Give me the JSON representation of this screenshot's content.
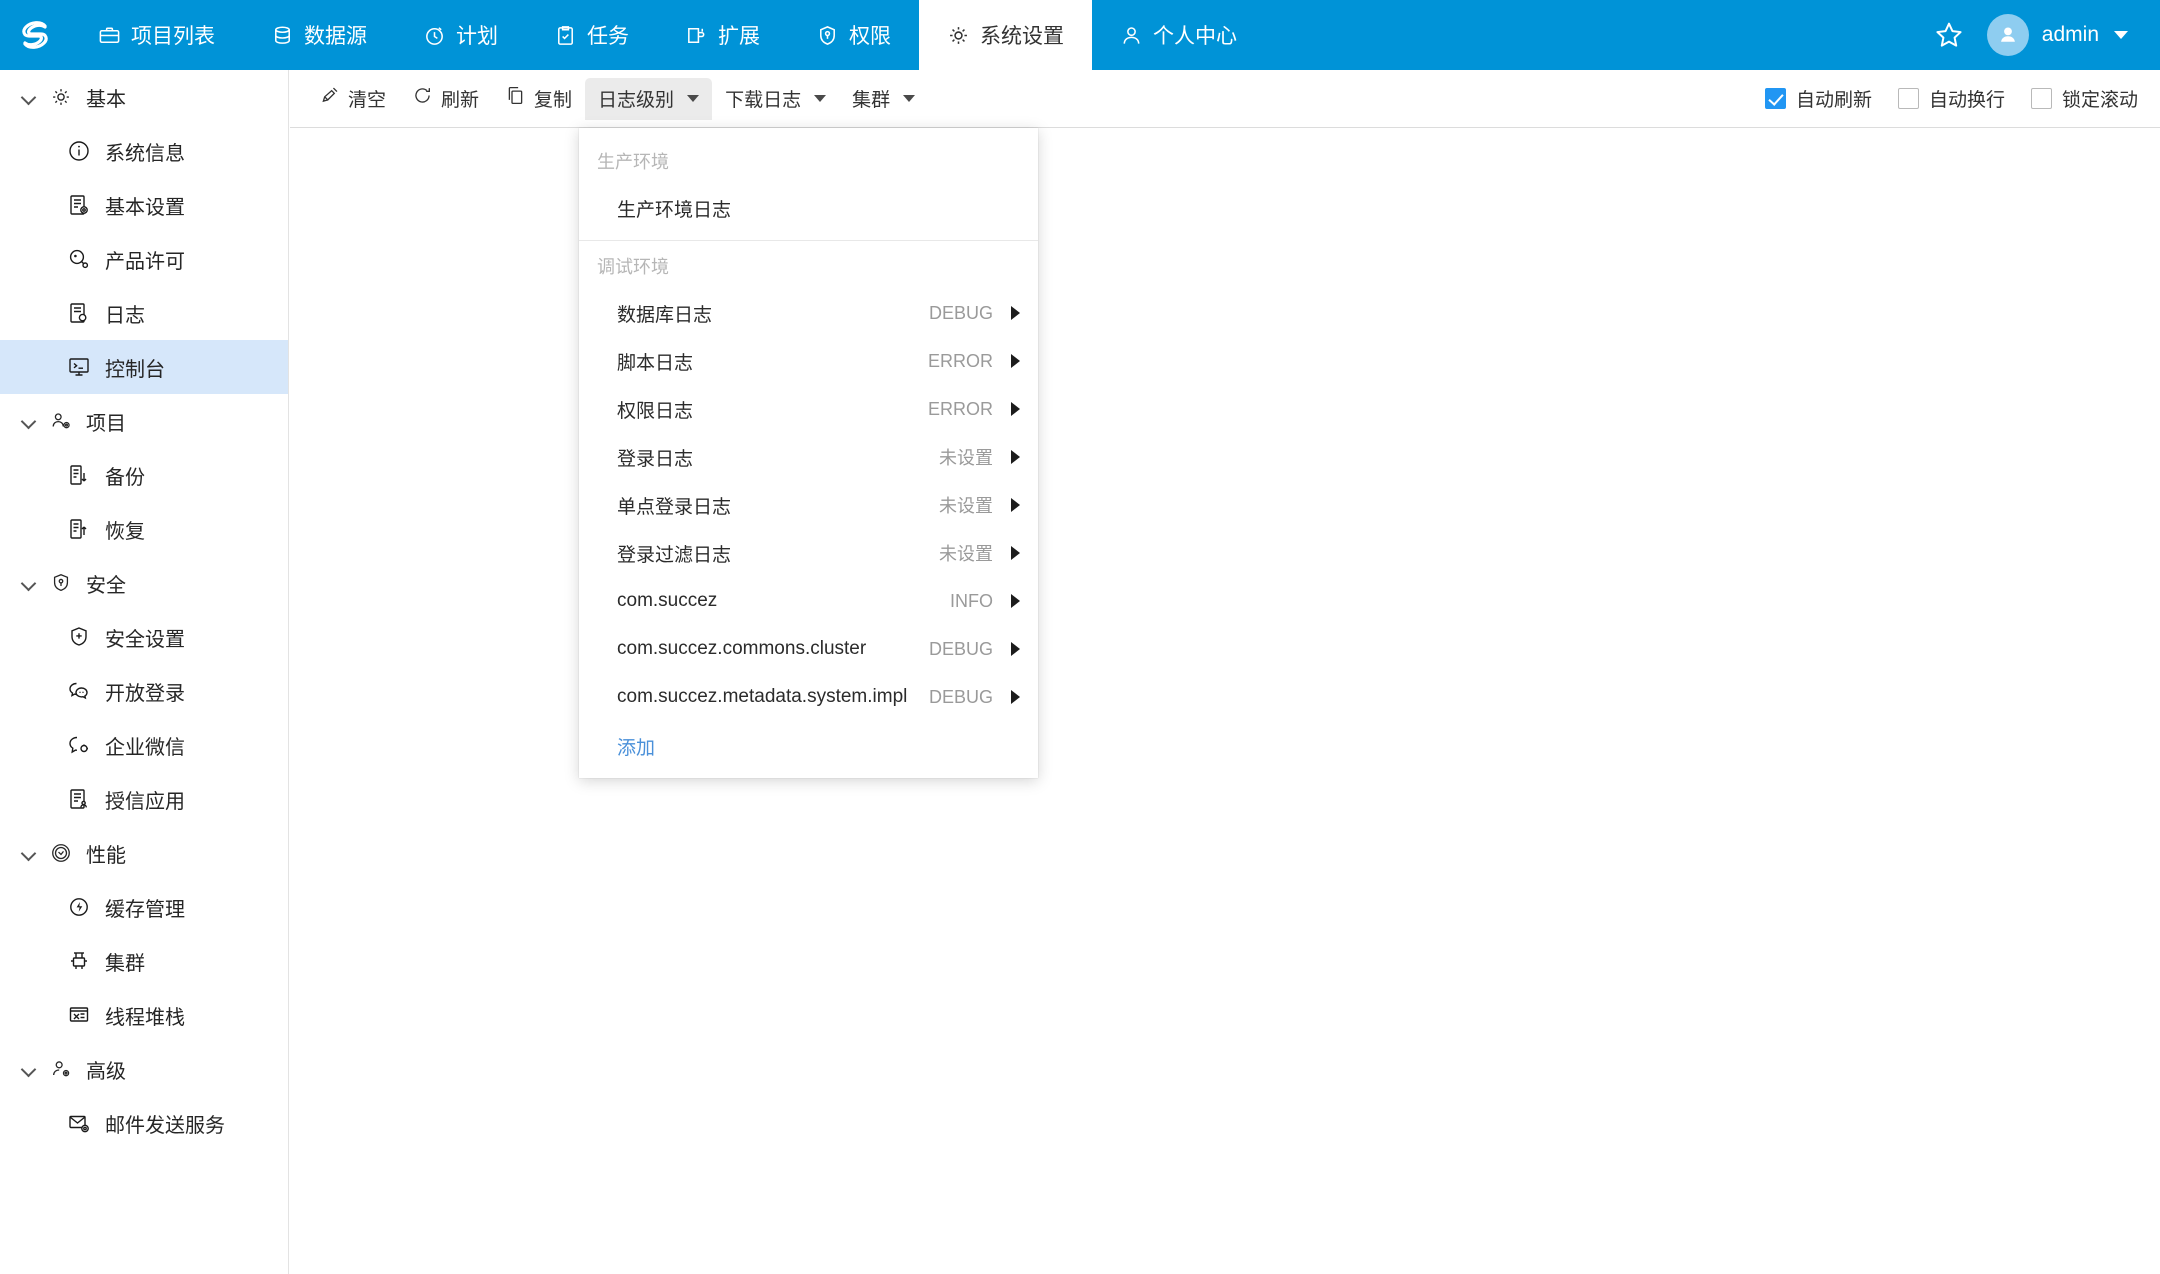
{
  "header": {
    "logo": "brand-logo",
    "nav": [
      {
        "label": "项目列表",
        "icon": "briefcase-icon",
        "active": false
      },
      {
        "label": "数据源",
        "icon": "database-icon",
        "active": false
      },
      {
        "label": "计划",
        "icon": "clock-icon",
        "active": false
      },
      {
        "label": "任务",
        "icon": "clipboard-check-icon",
        "active": false
      },
      {
        "label": "扩展",
        "icon": "extension-icon",
        "active": false
      },
      {
        "label": "权限",
        "icon": "shield-key-icon",
        "active": false
      },
      {
        "label": "系统设置",
        "icon": "gear-icon",
        "active": true
      },
      {
        "label": "个人中心",
        "icon": "user-icon",
        "active": false
      }
    ],
    "star_icon": "star-icon",
    "avatar_icon": "avatar-person-icon",
    "username": "admin",
    "user_caret": "chevron-down-icon",
    "bg_color": "#0093d7"
  },
  "sidebar": {
    "groups": [
      {
        "label": "基本",
        "icon": "gear-icon",
        "items": [
          {
            "label": "系统信息",
            "icon": "info-circle-icon",
            "selected": false
          },
          {
            "label": "基本设置",
            "icon": "document-gear-icon",
            "selected": false
          },
          {
            "label": "产品许可",
            "icon": "license-key-icon",
            "selected": false
          },
          {
            "label": "日志",
            "icon": "document-search-icon",
            "selected": false
          },
          {
            "label": "控制台",
            "icon": "console-monitor-icon",
            "selected": true
          }
        ]
      },
      {
        "label": "项目",
        "icon": "users-gear-icon",
        "items": [
          {
            "label": "备份",
            "icon": "backup-icon",
            "selected": false
          },
          {
            "label": "恢复",
            "icon": "restore-icon",
            "selected": false
          }
        ]
      },
      {
        "label": "安全",
        "icon": "shield-key-icon",
        "items": [
          {
            "label": "安全设置",
            "icon": "shield-plus-icon",
            "selected": false
          },
          {
            "label": "开放登录",
            "icon": "chat-bubbles-icon",
            "selected": false
          },
          {
            "label": "企业微信",
            "icon": "wechat-work-icon",
            "selected": false
          },
          {
            "label": "授信应用",
            "icon": "document-user-icon",
            "selected": false
          }
        ]
      },
      {
        "label": "性能",
        "icon": "gauge-smile-icon",
        "items": [
          {
            "label": "缓存管理",
            "icon": "cache-bolt-icon",
            "selected": false
          },
          {
            "label": "集群",
            "icon": "cluster-icon",
            "selected": false
          },
          {
            "label": "线程堆栈",
            "icon": "thread-stack-icon",
            "selected": false
          }
        ]
      },
      {
        "label": "高级",
        "icon": "user-gear-icon",
        "items": [
          {
            "label": "邮件发送服务",
            "icon": "mail-gear-icon",
            "selected": false
          }
        ]
      }
    ],
    "selected_bg": "#d6e7fa"
  },
  "toolbar": {
    "buttons": [
      {
        "label": "清空",
        "icon": "broom-icon",
        "has_caret": false,
        "open": false
      },
      {
        "label": "刷新",
        "icon": "refresh-icon",
        "has_caret": false,
        "open": false
      },
      {
        "label": "复制",
        "icon": "copy-icon",
        "has_caret": false,
        "open": false
      },
      {
        "label": "日志级别",
        "icon": "",
        "has_caret": true,
        "open": true
      },
      {
        "label": "下载日志",
        "icon": "",
        "has_caret": true,
        "open": false
      },
      {
        "label": "集群",
        "icon": "",
        "has_caret": true,
        "open": false
      }
    ],
    "checkboxes": [
      {
        "label": "自动刷新",
        "checked": true
      },
      {
        "label": "自动换行",
        "checked": false
      },
      {
        "label": "锁定滚动",
        "checked": false
      }
    ],
    "checked_color": "#2196f3"
  },
  "log_level_menu": {
    "group_production": "生产环境",
    "production_items": [
      {
        "label": "生产环境日志",
        "level": "",
        "arrow": false
      }
    ],
    "group_debug": "调试环境",
    "debug_items": [
      {
        "label": "数据库日志",
        "level": "DEBUG",
        "arrow": true
      },
      {
        "label": "脚本日志",
        "level": "ERROR",
        "arrow": true
      },
      {
        "label": "权限日志",
        "level": "ERROR",
        "arrow": true
      },
      {
        "label": "登录日志",
        "level": "未设置",
        "arrow": true
      },
      {
        "label": "单点登录日志",
        "level": "未设置",
        "arrow": true
      },
      {
        "label": "登录过滤日志",
        "level": "未设置",
        "arrow": true
      },
      {
        "label": "com.succez",
        "level": "INFO",
        "arrow": true
      },
      {
        "label": "com.succez.commons.cluster",
        "level": "DEBUG",
        "arrow": true
      },
      {
        "label": "com.succez.metadata.system.impl",
        "level": "DEBUG",
        "arrow": true
      }
    ],
    "add_label": "添加",
    "add_color": "#4a90d9"
  }
}
